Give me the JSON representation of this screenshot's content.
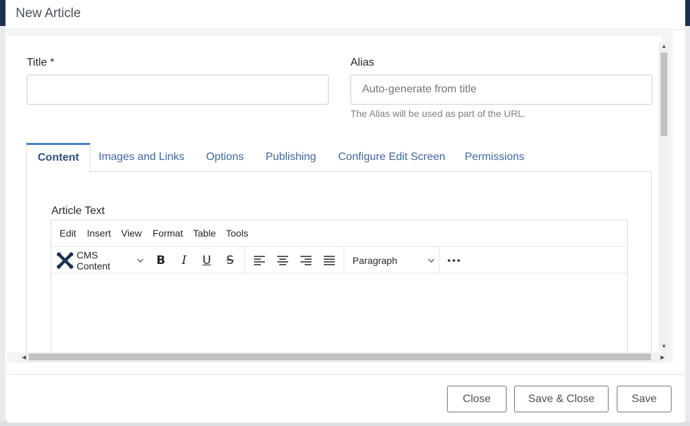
{
  "modal": {
    "title": "New Article"
  },
  "form": {
    "title_label": "Title *",
    "title_value": "",
    "alias_label": "Alias",
    "alias_placeholder": "Auto-generate from title",
    "alias_hint": "The Alias will be used as part of the URL."
  },
  "tabs": [
    {
      "label": "Content",
      "active": true
    },
    {
      "label": "Images and Links"
    },
    {
      "label": "Options"
    },
    {
      "label": "Publishing"
    },
    {
      "label": "Configure Edit Screen"
    },
    {
      "label": "Permissions"
    }
  ],
  "editor": {
    "label": "Article Text",
    "menu": [
      "Edit",
      "Insert",
      "View",
      "Format",
      "Table",
      "Tools"
    ],
    "cms_content": "CMS Content",
    "block_format": "Paragraph"
  },
  "footer": {
    "close": "Close",
    "save_close": "Save & Close",
    "save": "Save"
  },
  "colors": {
    "accent": "#4a7fc4",
    "link": "#3d67a3"
  }
}
